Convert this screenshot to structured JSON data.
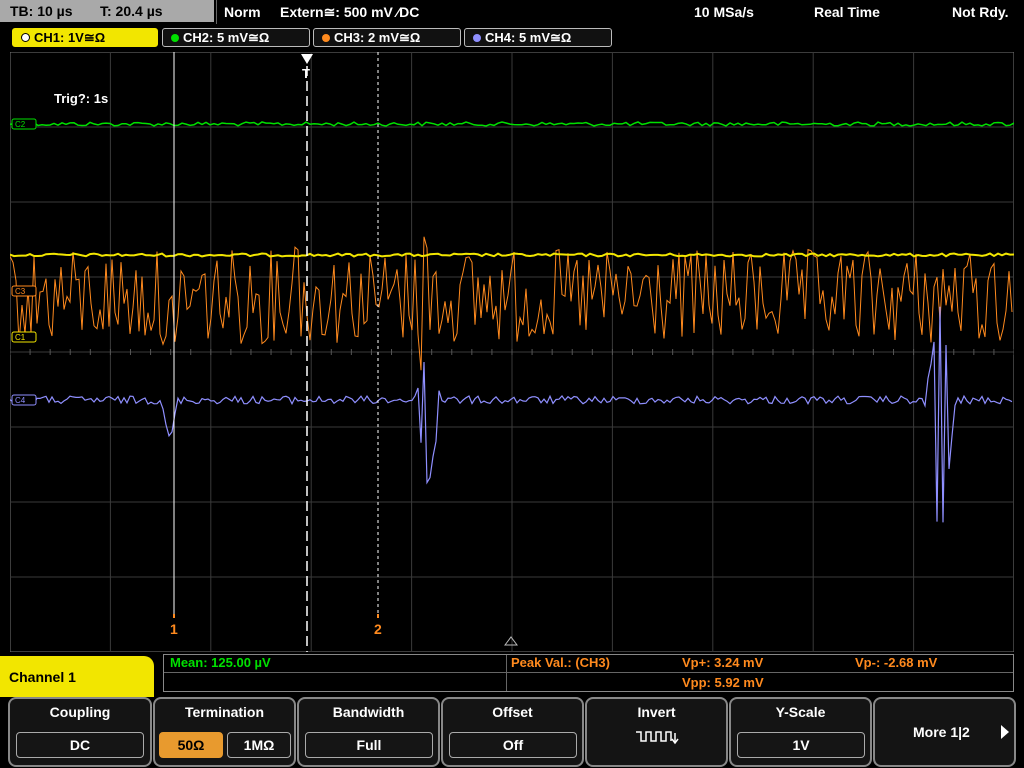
{
  "status": {
    "timebase": "TB: 10 µs",
    "trigger_time": "T: 20.4 µs",
    "trigger_mode": "Norm",
    "trigger_source": "Extern≅: 500 mV ⁄DC",
    "sample_rate": "10 MSa/s",
    "acq_mode": "Real Time",
    "state": "Not Rdy."
  },
  "channels": [
    {
      "label": "CH1: 1V≅Ω",
      "color": "#f2e600"
    },
    {
      "label": "CH2: 5 mV≅Ω",
      "color": "#00e000"
    },
    {
      "label": "CH3: 2 mV≅Ω",
      "color": "#ff8a1e"
    },
    {
      "label": "CH4: 5 mV≅Ω",
      "color": "#8f8fff"
    }
  ],
  "grid": {
    "trig_timeout": "Trig?: 1s",
    "trigger_marker": "T",
    "cursor1_label": "1",
    "cursor2_label": "2",
    "ch1_marker": "C1",
    "ch2_marker": "C2",
    "ch3_marker": "C3",
    "ch4_marker": "C4"
  },
  "measurements": {
    "mean": "Mean: 125.00 µV",
    "peak_title": "Peak Val.:  (CH3)",
    "vp_plus": "Vp+: 3.24 mV",
    "vpp": "Vpp: 5.92 mV",
    "vp_minus": "Vp-: -2.68 mV"
  },
  "menu": {
    "title": "Channel 1",
    "coupling_title": "Coupling",
    "coupling_value": "DC",
    "termination_title": "Termination",
    "term_50": "50Ω",
    "term_1m": "1MΩ",
    "bandwidth_title": "Bandwidth",
    "bandwidth_value": "Full",
    "offset_title": "Offset",
    "offset_value": "Off",
    "invert_title": "Invert",
    "yscale_title": "Y-Scale",
    "yscale_value": "1V",
    "more_label": "More 1|2"
  }
}
